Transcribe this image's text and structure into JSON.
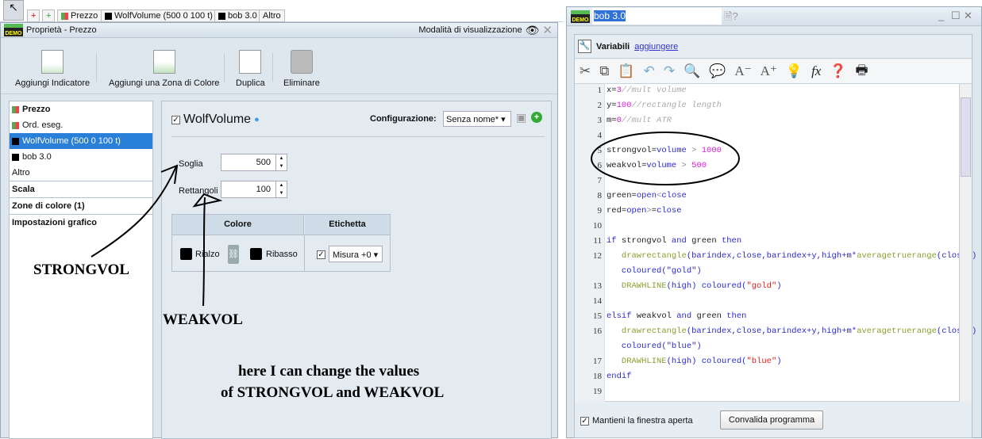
{
  "tabbar": {
    "items": [
      "Prezzo",
      "WolfVolume (500 0 100 t)",
      "bob 3.0",
      "Altro"
    ]
  },
  "left_window": {
    "title": "Proprietà - Prezzo",
    "view_mode": "Modalità di visualizzazione",
    "toolbar": [
      "Aggiungi Indicatore",
      "Aggiungi una Zona di Colore",
      "Duplica",
      "Eliminare"
    ],
    "sidebar": {
      "items": [
        "Prezzo",
        "Ord. eseg.",
        "WolfVolume (500 0 100 t)",
        "bob 3.0",
        "Altro"
      ],
      "sections": [
        "Scala",
        "Zone di colore (1)",
        "Impostazioni grafico"
      ],
      "selected": "WolfVolume (500 0 100 t)"
    },
    "panel": {
      "indicator": "WolfVolume",
      "config_label": "Configurazione:",
      "config_value": "Senza nome*",
      "params": [
        {
          "label": "Soglia",
          "value": "500"
        },
        {
          "label": "Rettangoli",
          "value": "100"
        }
      ],
      "table": {
        "headers": [
          "Colore",
          "Etichetta"
        ],
        "rialzo": "Rialzo",
        "ribasso": "Ribasso",
        "label_value": "Misura +0"
      }
    }
  },
  "right_window": {
    "title_input": "bob 3.0",
    "variables": "Variabili",
    "add_link": "aggiungere",
    "code": [
      [
        [
          "",
          "x="
        ],
        [
          "n",
          "3"
        ],
        [
          "c",
          "//mult volume"
        ]
      ],
      [
        [
          "",
          "y="
        ],
        [
          "n",
          "100"
        ],
        [
          "c",
          "//rectangle length"
        ]
      ],
      [
        [
          "",
          "m="
        ],
        [
          "n",
          "0"
        ],
        [
          "c",
          "//mult ATR"
        ]
      ],
      [],
      [
        [
          "",
          "strongvol="
        ],
        [
          "k",
          "volume"
        ],
        [
          "o",
          " > "
        ],
        [
          "n",
          "1000"
        ]
      ],
      [
        [
          "",
          "weakvol="
        ],
        [
          "k",
          "volume"
        ],
        [
          "o",
          " > "
        ],
        [
          "n",
          "500"
        ]
      ],
      [],
      [
        [
          "",
          "green="
        ],
        [
          "k",
          "open"
        ],
        [
          "o",
          "<"
        ],
        [
          "k",
          "close"
        ]
      ],
      [
        [
          "",
          "red="
        ],
        [
          "k",
          "open"
        ],
        [
          "o",
          ">"
        ],
        [
          "",
          "="
        ],
        [
          "k",
          "close"
        ]
      ],
      [],
      [
        [
          "k",
          "if"
        ],
        [
          "",
          " strongvol "
        ],
        [
          "k",
          "and"
        ],
        [
          "",
          " green "
        ],
        [
          "k",
          "then"
        ]
      ],
      [
        [
          "",
          "   "
        ],
        [
          "f",
          "drawrectangle"
        ],
        [
          "k",
          "(barindex,close,barindex+y,high+m*"
        ],
        [
          "f",
          "averagetruerange"
        ],
        [
          "k",
          "(close))"
        ]
      ],
      [
        [
          "",
          "   "
        ],
        [
          "f",
          "DRAWHLINE"
        ],
        [
          "k",
          "(high) coloured("
        ],
        [
          "s",
          "\"gold\""
        ],
        [
          "k",
          ")"
        ]
      ],
      [],
      [
        [
          "k",
          "elsif"
        ],
        [
          "",
          " weakvol "
        ],
        [
          "k",
          "and"
        ],
        [
          "",
          " green "
        ],
        [
          "k",
          "then"
        ]
      ],
      [
        [
          "",
          "   "
        ],
        [
          "f",
          "drawrectangle"
        ],
        [
          "k",
          "(barindex,close,barindex+y,high+m*"
        ],
        [
          "f",
          "averagetruerange"
        ],
        [
          "k",
          "(close))"
        ]
      ],
      [
        [
          "",
          "   "
        ],
        [
          "f",
          "DRAWHLINE"
        ],
        [
          "k",
          "(high) coloured("
        ],
        [
          "s",
          "\"blue\""
        ],
        [
          "k",
          ")"
        ]
      ],
      [
        [
          "k",
          "endif"
        ]
      ],
      []
    ],
    "wrap_gold": "coloured(\"gold\")",
    "wrap_blue": "coloured(\"blue\")",
    "keep_open": "Mantieni la finestra aperta",
    "validate": "Convalida programma"
  },
  "annotations": {
    "strong": "STRONGVOL",
    "weak": "WEAKVOL",
    "note1": "here I can change the values",
    "note2": "of STRONGVOL and WEAKVOL"
  },
  "logo": "DEMO"
}
